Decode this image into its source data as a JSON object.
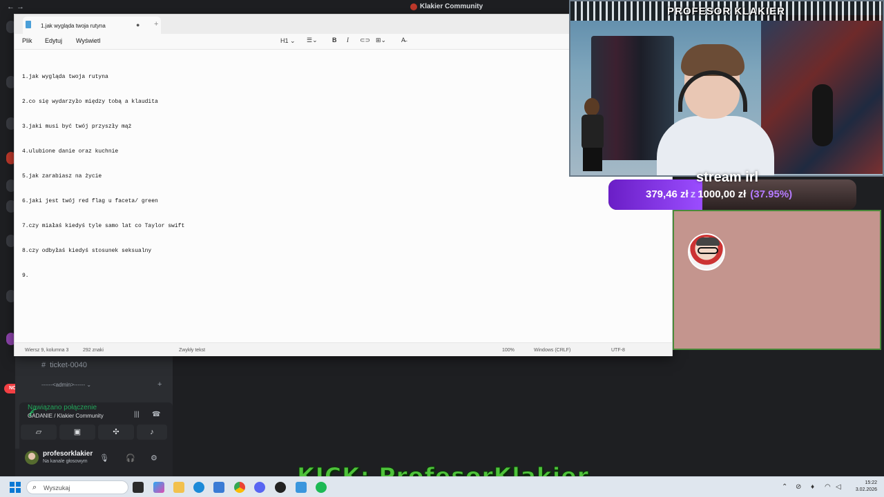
{
  "discord": {
    "window_title": "Klakier Community",
    "channels": {
      "ticket": "ticket-0040",
      "admin_category": "------<admin>------"
    },
    "badges": {
      "mentions": "14",
      "new": "NOWE"
    },
    "voice": {
      "status": "Nawiązano połączenie",
      "channel": "GADANIE / Klakier Community"
    },
    "user": {
      "name": "profesorklakier",
      "status": "Na kanale głosowym"
    }
  },
  "notepad": {
    "tab_title": "1.jak wygląda twoja rutyna",
    "menu": [
      "Plik",
      "Edytuj",
      "Wyświetl"
    ],
    "heading_format": "H1",
    "lines": [
      "1.jak wygląda twoja rutyna",
      "2.co się wydarzyło między tobą a klaudita",
      "3.jaki musi być twój przyszły mąż",
      "4.ulubione danie oraz kuchnie",
      "5.jak zarabiasz na życie",
      "6.jaki jest twój red flag u faceta/ green",
      "7.czy miałaś kiedyś tyle samo lat co Taylor swift",
      "8.czy odbyłaś kiedyś stosunek seksualny",
      "9."
    ],
    "status": {
      "position": "Wiersz 9, kolumna 3",
      "chars": "292 znaki",
      "format": "Zwykły tekst",
      "zoom": "100%",
      "line_ending": "Windows (CRLF)",
      "encoding": "UTF-8"
    }
  },
  "stream": {
    "streamer_name": "PROFESOR KLAKIER",
    "goal": {
      "title": "stream irl",
      "current": "379,46 zł",
      "separator": "z",
      "target": "1000,00 zł",
      "percent_label": "(37.95%)",
      "progress": 0.3795
    },
    "kick_banner": "KICK: ProfesorKlakier"
  },
  "taskbar": {
    "search_placeholder": "Wyszukaj",
    "time": "15:22",
    "date": "3.02.2026"
  },
  "colors": {
    "goal_fill": "#9b4dff",
    "kick_green": "#4ec23a",
    "voice_green": "#23a55a",
    "pink_panel": "#c4958e"
  }
}
